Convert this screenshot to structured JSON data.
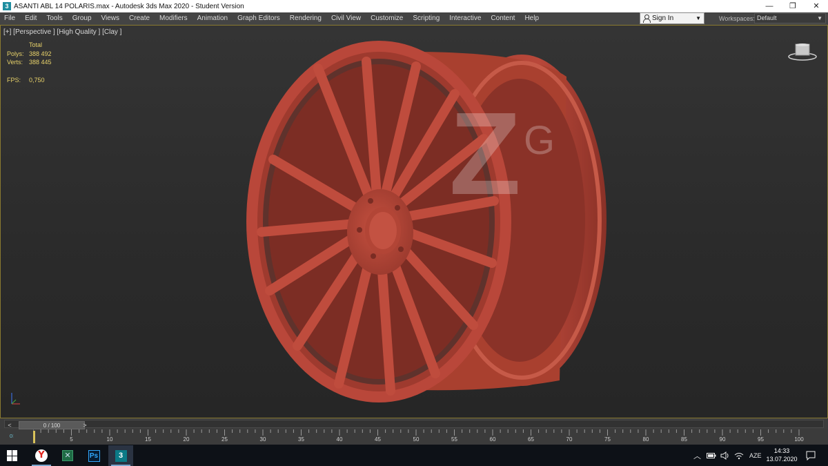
{
  "window": {
    "app_icon_label": "3",
    "title": "ASANTI ABL 14 POLARIS.max - Autodesk 3ds Max 2020 - Student Version",
    "minimize": "—",
    "maximize": "❐",
    "close": "✕"
  },
  "menu": {
    "items": [
      "File",
      "Edit",
      "Tools",
      "Group",
      "Views",
      "Create",
      "Modifiers",
      "Animation",
      "Graph Editors",
      "Rendering",
      "Civil View",
      "Customize",
      "Scripting",
      "Interactive",
      "Content",
      "Help"
    ],
    "sign_in": "Sign In",
    "workspaces_label": "Workspaces:",
    "workspace_value": "Default"
  },
  "viewport": {
    "label": "[+] [Perspective ] [High Quality ] [Clay ]",
    "stats": {
      "header": "Total",
      "polys_label": "Polys:",
      "polys_value": "388 492",
      "verts_label": "Verts:",
      "verts_value": "388 445",
      "fps_label": "FPS:",
      "fps_value": "0,750"
    },
    "watermark_text": "Z",
    "watermark_sub": "G",
    "wheel_color": "#b8493c"
  },
  "timeslider": {
    "value_label": "0 / 100",
    "prev_arrow": "<",
    "next_arrow": ">",
    "current_frame": 0,
    "total_frames": 100
  },
  "trackbar": {
    "key_label": "0∶",
    "ticks": [
      "5",
      "10",
      "15",
      "20",
      "25",
      "30",
      "35",
      "40",
      "45",
      "50",
      "55",
      "60",
      "65",
      "70",
      "75",
      "80",
      "85",
      "90",
      "95",
      "100"
    ]
  },
  "taskbar": {
    "apps": [
      {
        "name": "yandex-browser",
        "glyph": "Y",
        "active": true
      },
      {
        "name": "green-app",
        "glyph": "✕",
        "active": false
      },
      {
        "name": "photoshop",
        "glyph": "Ps",
        "active": false
      },
      {
        "name": "3ds-max",
        "glyph": "3",
        "active": true
      }
    ],
    "language": "AZE",
    "time": "14:33",
    "date": "13.07.2020"
  }
}
